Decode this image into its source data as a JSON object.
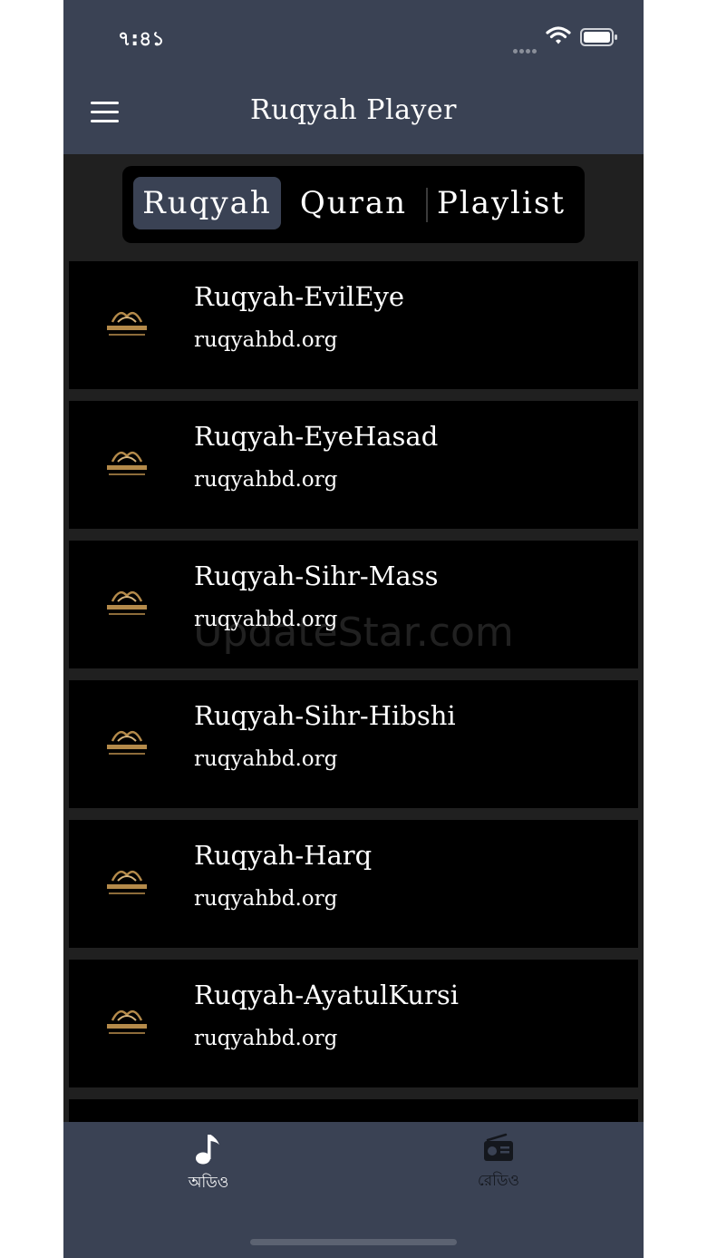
{
  "status_bar": {
    "time": "৭:৪১"
  },
  "header": {
    "title": "Ruqyah Player",
    "menu_icon": "hamburger-menu-icon"
  },
  "segments": [
    {
      "label": "Ruqyah",
      "selected": true
    },
    {
      "label": "Quran",
      "selected": false
    },
    {
      "label": "Playlist",
      "selected": false
    }
  ],
  "tracks": [
    {
      "title": "Ruqyah-EvilEye",
      "source": "ruqyahbd.org"
    },
    {
      "title": "Ruqyah-EyeHasad",
      "source": "ruqyahbd.org"
    },
    {
      "title": "Ruqyah-Sihr-Mass",
      "source": "ruqyahbd.org"
    },
    {
      "title": "Ruqyah-Sihr-Hibshi",
      "source": "ruqyahbd.org"
    },
    {
      "title": "Ruqyah-Harq",
      "source": "ruqyahbd.org"
    },
    {
      "title": "Ruqyah-AyatulKursi",
      "source": "ruqyahbd.org"
    }
  ],
  "watermark": "UpdateStar.com",
  "tabbar": {
    "tabs": [
      {
        "label": "অডিও",
        "icon": "music-note-icon",
        "active": true
      },
      {
        "label": "রেডিও",
        "icon": "radio-icon",
        "active": false
      }
    ]
  },
  "colors": {
    "bar": "#3a4254",
    "background": "#202020",
    "row": "#000000"
  }
}
